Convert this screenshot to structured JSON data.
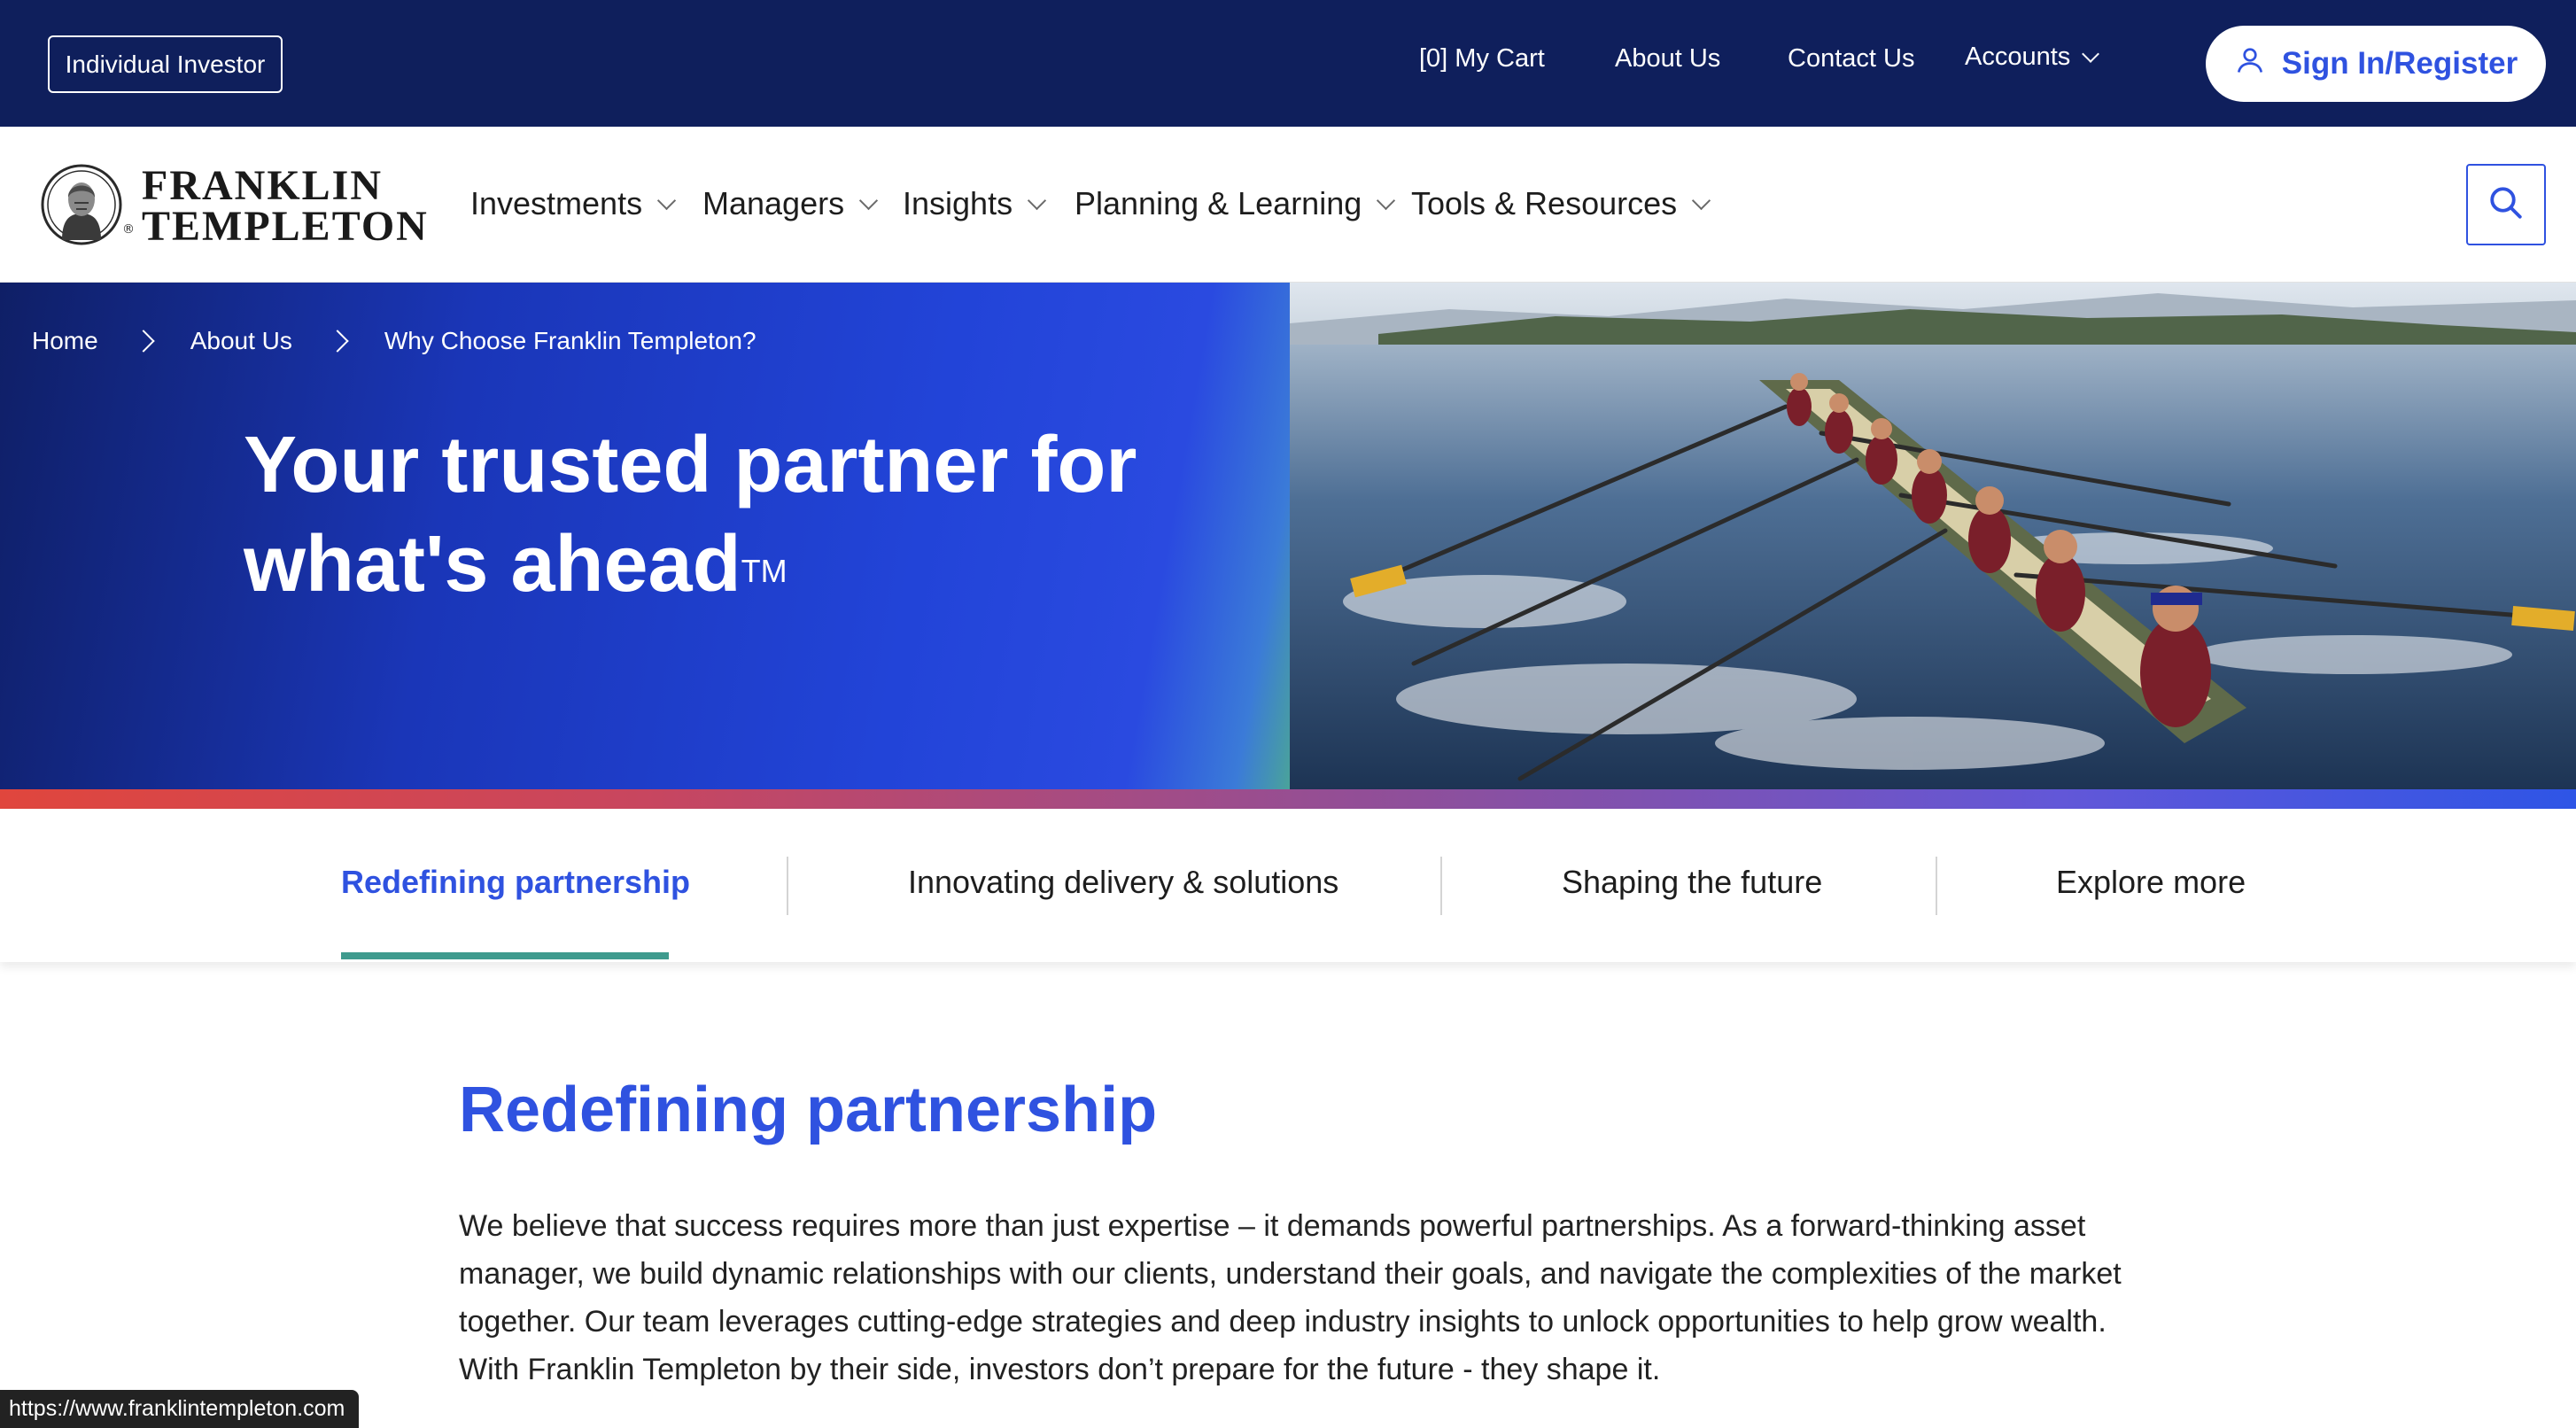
{
  "topbar": {
    "investor_type": "Individual Investor",
    "cart": "[0] My Cart",
    "about": "About Us",
    "contact": "Contact Us",
    "accounts": "Accounts",
    "sign_in": "Sign In/Register"
  },
  "nav": {
    "logo_line1": "FRANKLIN",
    "logo_line2": "TEMPLETON",
    "items": [
      {
        "label": "Investments"
      },
      {
        "label": "Managers"
      },
      {
        "label": "Insights"
      },
      {
        "label": "Planning & Learning"
      },
      {
        "label": "Tools & Resources"
      }
    ]
  },
  "breadcrumb": [
    "Home",
    "About Us",
    "Why Choose Franklin Templeton?"
  ],
  "hero": {
    "title_line1": "Your trusted partner for",
    "title_line2": "what's ahead",
    "trademark": "TM"
  },
  "tabs": [
    {
      "label": "Redefining partnership",
      "active": true
    },
    {
      "label": "Innovating delivery & solutions",
      "active": false
    },
    {
      "label": "Shaping the future",
      "active": false
    },
    {
      "label": "Explore more",
      "active": false
    }
  ],
  "section": {
    "title": "Redefining partnership",
    "body": "We believe that success requires more than just expertise – it demands powerful partnerships. As a forward-thinking asset manager, we build dynamic relationships with our clients, understand their goals, and navigate the complexities of the market together. Our team leverages cutting-edge strategies and deep industry insights to unlock opportunities to help grow wealth. With Franklin Templeton by their side, investors don’t prepare for the future - they shape it."
  },
  "status_url": "https://www.franklintempleton.com",
  "colors": {
    "navy": "#0f1f5c",
    "brand_blue": "#2f52e0",
    "tab_underline": "#3f9b8e"
  }
}
